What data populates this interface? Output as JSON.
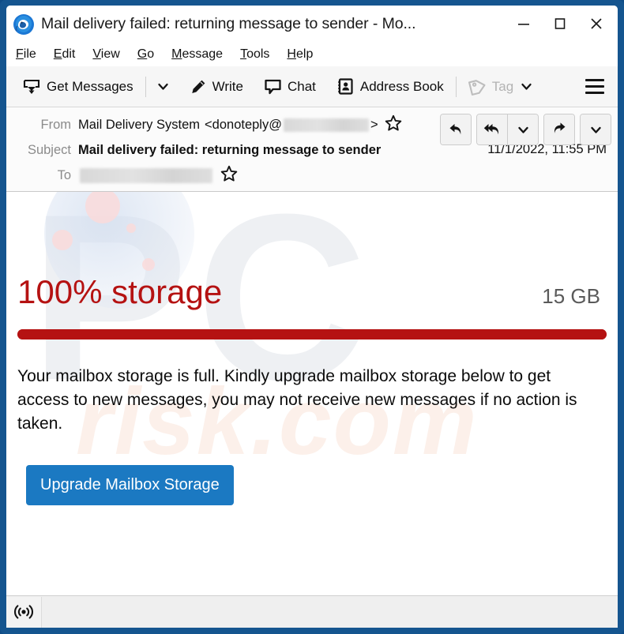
{
  "window": {
    "title": "Mail delivery failed: returning message to sender - Mo...",
    "app_icon": "thunderbird-icon",
    "controls": {
      "minimize": "minimize-icon",
      "maximize": "maximize-icon",
      "close": "close-icon"
    }
  },
  "menu": {
    "items": [
      {
        "label": "File",
        "accesskey": "F"
      },
      {
        "label": "Edit",
        "accesskey": "E"
      },
      {
        "label": "View",
        "accesskey": "V"
      },
      {
        "label": "Go",
        "accesskey": "G"
      },
      {
        "label": "Message",
        "accesskey": "M"
      },
      {
        "label": "Tools",
        "accesskey": "T"
      },
      {
        "label": "Help",
        "accesskey": "H"
      }
    ]
  },
  "toolbar": {
    "get_messages": "Get Messages",
    "get_messages_icon": "get-messages-icon",
    "write": "Write",
    "write_icon": "pencil-icon",
    "chat": "Chat",
    "chat_icon": "chat-bubble-icon",
    "address_book": "Address Book",
    "address_book_icon": "address-book-icon",
    "tag": "Tag",
    "tag_icon": "tag-icon",
    "app_menu_icon": "hamburger-icon"
  },
  "message_header": {
    "from_label": "From",
    "from_name": "Mail Delivery System",
    "from_address_prefix": "<donoteply@",
    "from_address_suffix": ">",
    "subject_label": "Subject",
    "subject": "Mail delivery failed: returning message to sender",
    "to_label": "To",
    "date": "11/1/2022, 11:55 PM",
    "star_icon": "star-icon",
    "actions": {
      "reply": "reply-icon",
      "reply_all": "reply-all-icon",
      "reply_all_menu": "chevron-down-icon",
      "forward": "forward-icon",
      "more_menu": "chevron-down-icon"
    }
  },
  "message_body": {
    "storage_percent": "100% storage",
    "storage_size": "15 GB",
    "paragraph": "Your mailbox storage is full. Kindly upgrade mailbox storage below to get access to new messages, you may not receive new messages if no action is taken.",
    "cta_label": "Upgrade Mailbox Storage",
    "watermark_main": "PC",
    "watermark_sub": "risk.com"
  },
  "status_bar": {
    "icon": "broadcast-icon"
  },
  "colors": {
    "window_frame": "#15558f",
    "storage_red": "#b51212",
    "cta_blue": "#1b79c2",
    "toolbar_bg": "#f6f6f6",
    "disabled_gray": "#b3b3b3"
  }
}
